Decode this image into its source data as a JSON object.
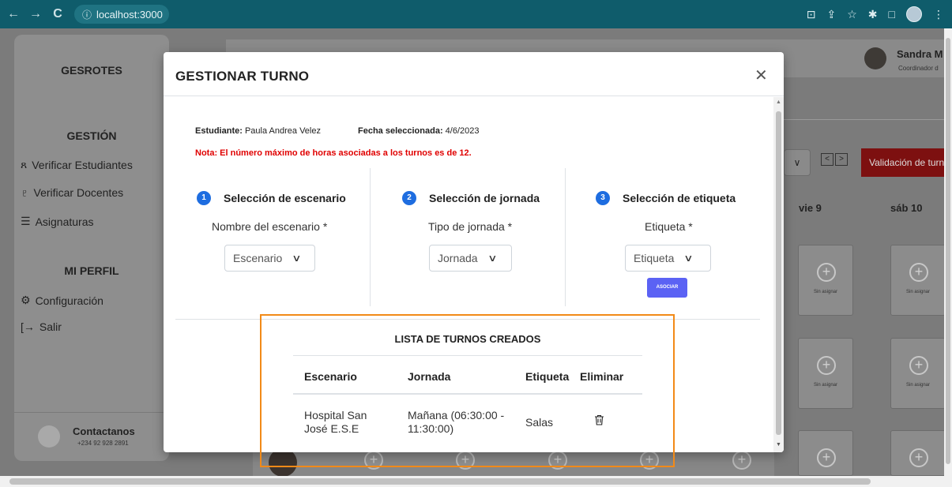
{
  "browser": {
    "url": "localhost:3000"
  },
  "sidebar": {
    "brand": "GESROTES",
    "section_gestion": "GESTIÓN",
    "items": [
      {
        "label": "Verificar Estudiantes"
      },
      {
        "label": "Verificar Docentes"
      },
      {
        "label": "Asignaturas"
      }
    ],
    "section_perfil": "MI PERFIL",
    "profile_items": [
      {
        "label": "Configuración"
      },
      {
        "label": "Salir"
      }
    ],
    "contact": {
      "title": "Contactanos",
      "phone": "+234 92 928 2891"
    }
  },
  "user": {
    "name": "Sandra M",
    "role": "Coordinador d"
  },
  "calendar": {
    "validate_button": "Validación de turno",
    "pager_prev": "<",
    "pager_next": ">",
    "days": [
      "vie 9",
      "sáb 10"
    ],
    "slot_label": "Sin asignar"
  },
  "modal": {
    "title": "GESTIONAR TURNO",
    "student_label": "Estudiante:",
    "student_value": "Paula Andrea Velez",
    "date_label": "Fecha seleccionada:",
    "date_value": "4/6/2023",
    "note": "Nota: El número máximo de horas asociadas a los turnos es de 12.",
    "steps": [
      {
        "num": "1",
        "title": "Selección de escenario",
        "field_label": "Nombre del escenario *",
        "select_value": "Escenario"
      },
      {
        "num": "2",
        "title": "Selección de jornada",
        "field_label": "Tipo de jornada *",
        "select_value": "Jornada"
      },
      {
        "num": "3",
        "title": "Selección de etiqueta",
        "field_label": "Etiqueta *",
        "select_value": "Etiqueta"
      }
    ],
    "associate_button": "ASOCIAR",
    "list": {
      "title": "LISTA DE TURNOS CREADOS",
      "columns": [
        "Escenario",
        "Jornada",
        "Etiqueta",
        "Eliminar"
      ],
      "rows": [
        {
          "escenario_l1": "Hospital San",
          "escenario_l2": "José E.S.E",
          "jornada_l1": "Mañana (06:30:00 -",
          "jornada_l2": "11:30:00)",
          "etiqueta": "Salas"
        }
      ]
    }
  },
  "colors": {
    "accent": "#5b62f4",
    "step_badge": "#1e6de0",
    "note": "#e00000",
    "highlight": "#f28a18",
    "validate": "#cc1414"
  }
}
